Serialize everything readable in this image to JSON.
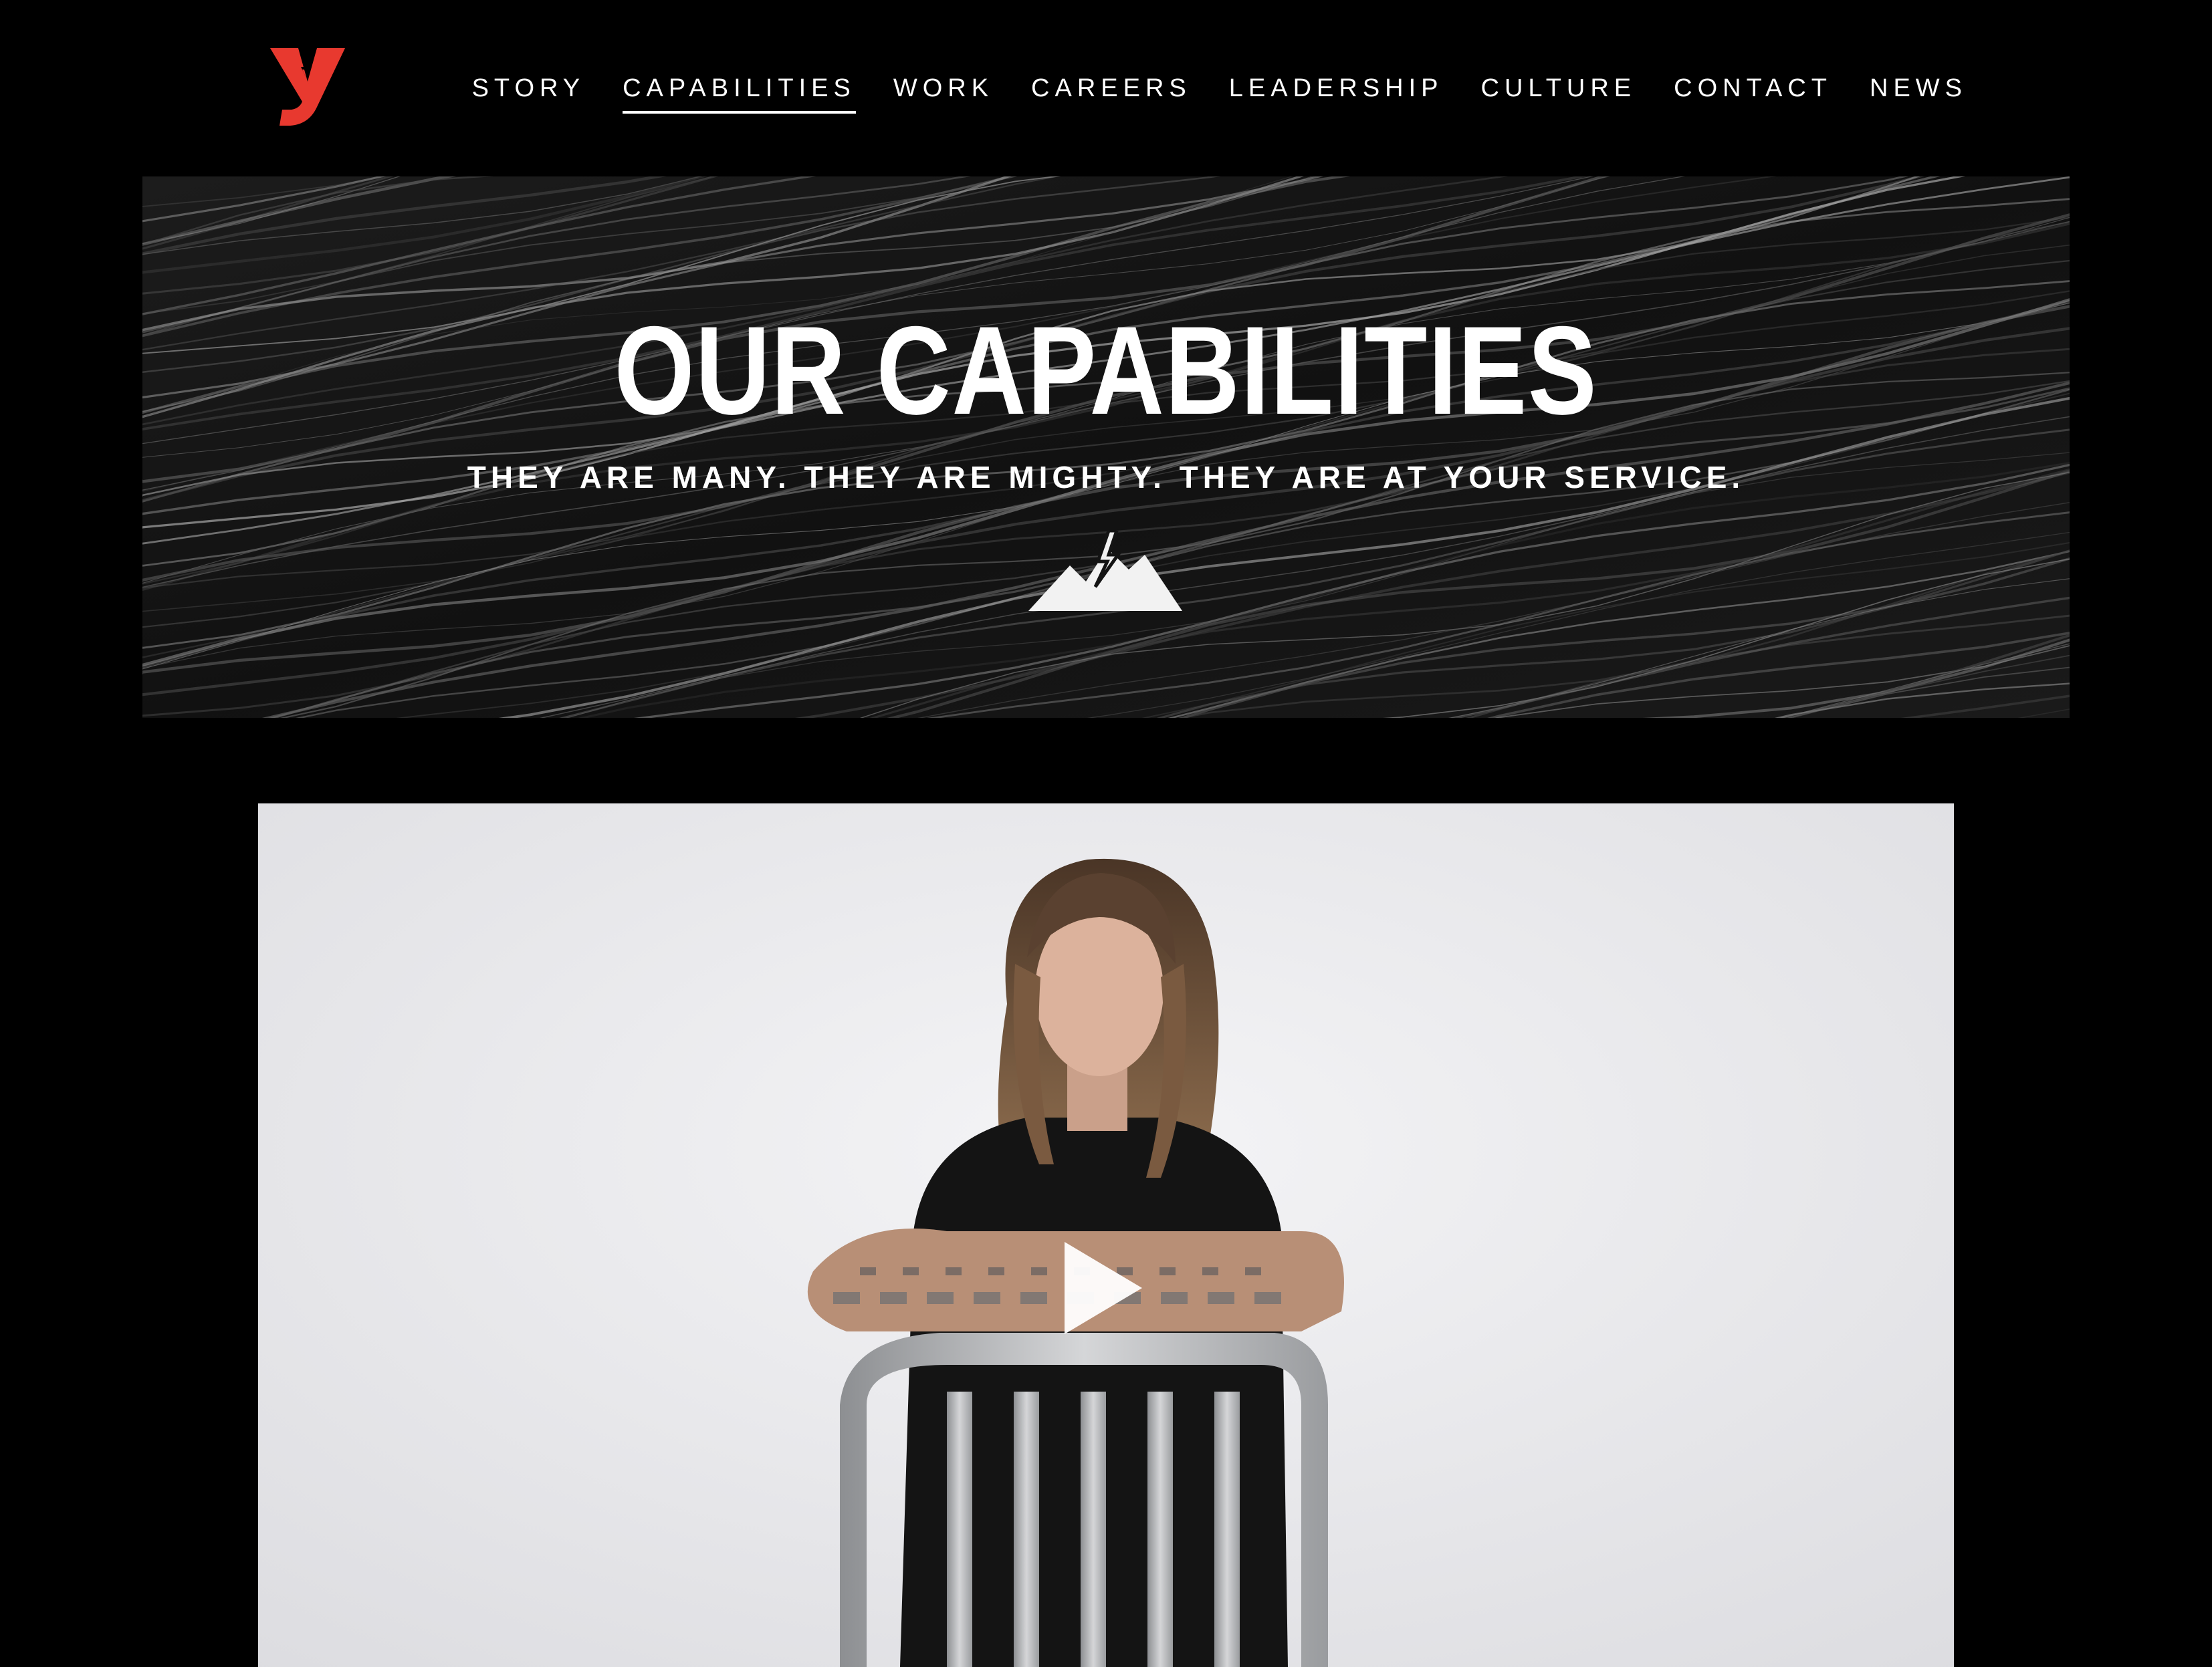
{
  "header": {
    "logo": {
      "icon": "brand-y-logo-icon",
      "color": "#e8392f"
    },
    "nav": [
      {
        "label": "STORY",
        "active": false
      },
      {
        "label": "CAPABILITIES",
        "active": true
      },
      {
        "label": "WORK",
        "active": false
      },
      {
        "label": "CAREERS",
        "active": false
      },
      {
        "label": "LEADERSHIP",
        "active": false
      },
      {
        "label": "CULTURE",
        "active": false
      },
      {
        "label": "CONTACT",
        "active": false
      },
      {
        "label": "NEWS",
        "active": false
      }
    ]
  },
  "hero": {
    "title": "OUR CAPABILITIES",
    "subtitle": "THEY ARE MANY. THEY ARE MIGHTY. THEY ARE AT YOUR SERVICE.",
    "icon": "mountain-lightning-icon",
    "background": "dark-stone-texture"
  },
  "video": {
    "thumbnail": "person-seated-on-chair",
    "play_icon": "play-icon"
  },
  "colors": {
    "background": "#000000",
    "text": "#ffffff",
    "accent": "#e8392f",
    "video_backdrop": "#ebebee"
  }
}
